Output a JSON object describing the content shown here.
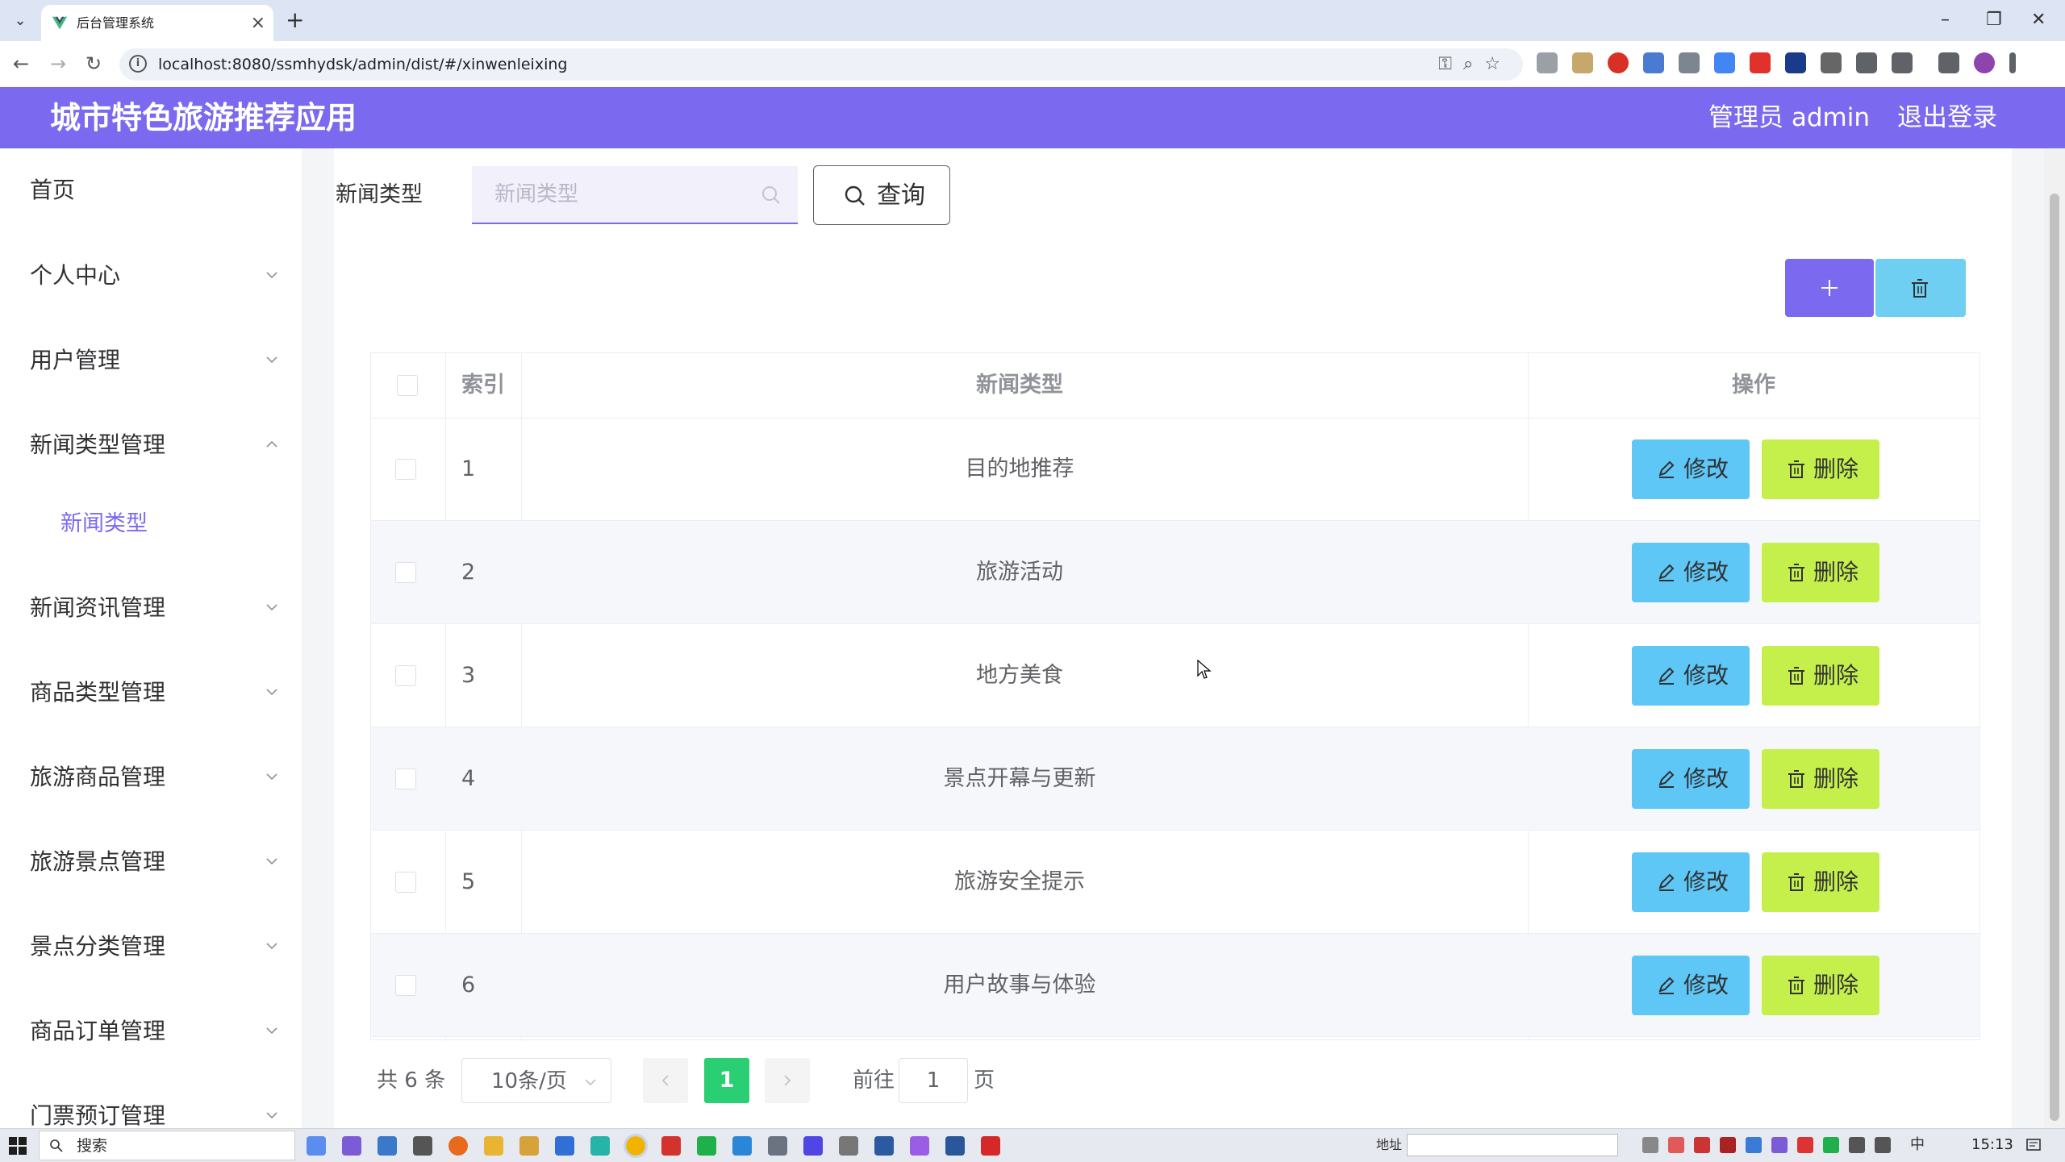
{
  "browser": {
    "tab_title": "后台管理系统",
    "url": "localhost:8080/ssmhydsk/admin/dist/#/xinwenleixing",
    "tab_close": "×",
    "tab_new": "+",
    "window_controls": {
      "minimize": "–",
      "maximize": "❐",
      "close": "✕"
    }
  },
  "header": {
    "title": "城市特色旅游推荐应用",
    "user": "管理员 admin",
    "logout": "退出登录"
  },
  "sidebar": {
    "items": [
      {
        "label": "首页"
      },
      {
        "label": "个人中心"
      },
      {
        "label": "用户管理"
      },
      {
        "label": "新闻类型管理"
      },
      {
        "label": "新闻资讯管理"
      },
      {
        "label": "商品类型管理"
      },
      {
        "label": "旅游商品管理"
      },
      {
        "label": "旅游景点管理"
      },
      {
        "label": "景点分类管理"
      },
      {
        "label": "商品订单管理"
      },
      {
        "label": "门票预订管理"
      }
    ],
    "active_submenu": "新闻类型"
  },
  "search": {
    "label": "新闻类型",
    "placeholder": "新闻类型",
    "query_button": "查询"
  },
  "table": {
    "headers": {
      "index": "索引",
      "name": "新闻类型",
      "action": "操作"
    },
    "rows": [
      {
        "index": "1",
        "name": "目的地推荐"
      },
      {
        "index": "2",
        "name": "旅游活动"
      },
      {
        "index": "3",
        "name": "地方美食"
      },
      {
        "index": "4",
        "name": "景点开幕与更新"
      },
      {
        "index": "5",
        "name": "旅游安全提示"
      },
      {
        "index": "6",
        "name": "用户故事与体验"
      }
    ],
    "edit_label": "修改",
    "delete_label": "删除"
  },
  "pagination": {
    "total": "共 6 条",
    "page_size": "10条/页",
    "current_page": "1",
    "goto_label": "前往",
    "goto_value": "1",
    "goto_suffix": "页"
  },
  "taskbar": {
    "search_text": "搜索",
    "address_label": "地址",
    "ime": "中",
    "time": "15:13"
  },
  "colors": {
    "primary": "#7b6af0",
    "edit": "#5ec7f5",
    "delete": "#c5f04c",
    "page_active": "#2bcf73"
  }
}
